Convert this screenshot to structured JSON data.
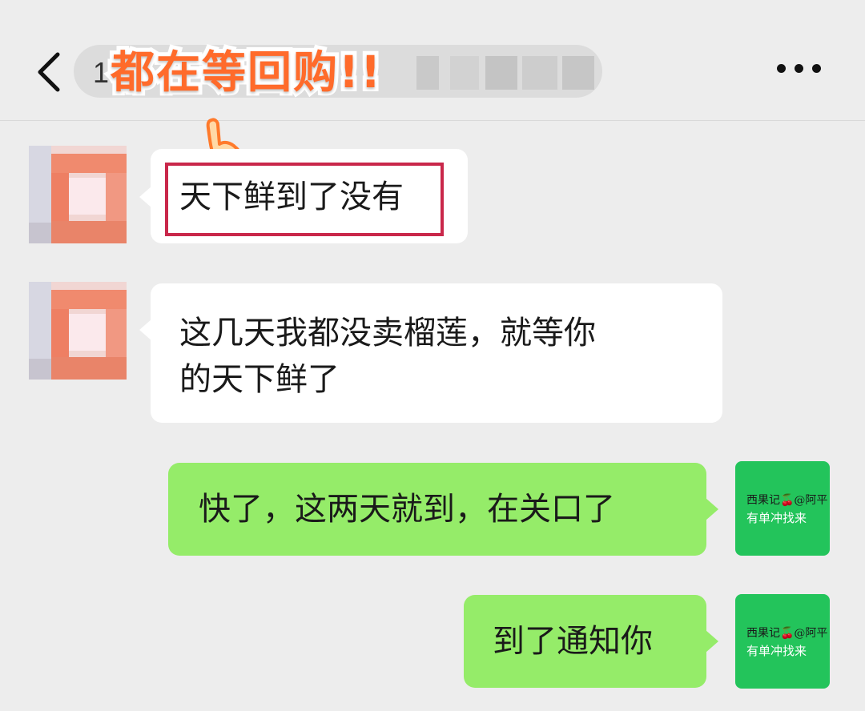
{
  "header": {
    "title_visible_prefix": "1",
    "banner": "都在等回购!!"
  },
  "messages": [
    {
      "side": "left",
      "text": "天下鲜到了没有",
      "highlighted": true
    },
    {
      "side": "left",
      "text_line1": "这几天我都没卖榴莲，就等你",
      "text_line2": "的天下鲜了"
    },
    {
      "side": "right",
      "text": "快了，这两天就到，在关口了"
    },
    {
      "side": "right",
      "text": "到了通知你"
    }
  ],
  "self_avatar": {
    "line1": "西果记🍒@阿平",
    "line2": "有单冲找来"
  },
  "colors": {
    "background": "#ededed",
    "incoming_bubble": "#ffffff",
    "outgoing_bubble": "#95ec69",
    "highlight_border": "#c9274a",
    "banner_text": "#ff6b2b",
    "self_avatar_bg": "#23c45b"
  },
  "icons": [
    "back-chevron-icon",
    "more-dots-icon",
    "pointing-hand-icon"
  ]
}
